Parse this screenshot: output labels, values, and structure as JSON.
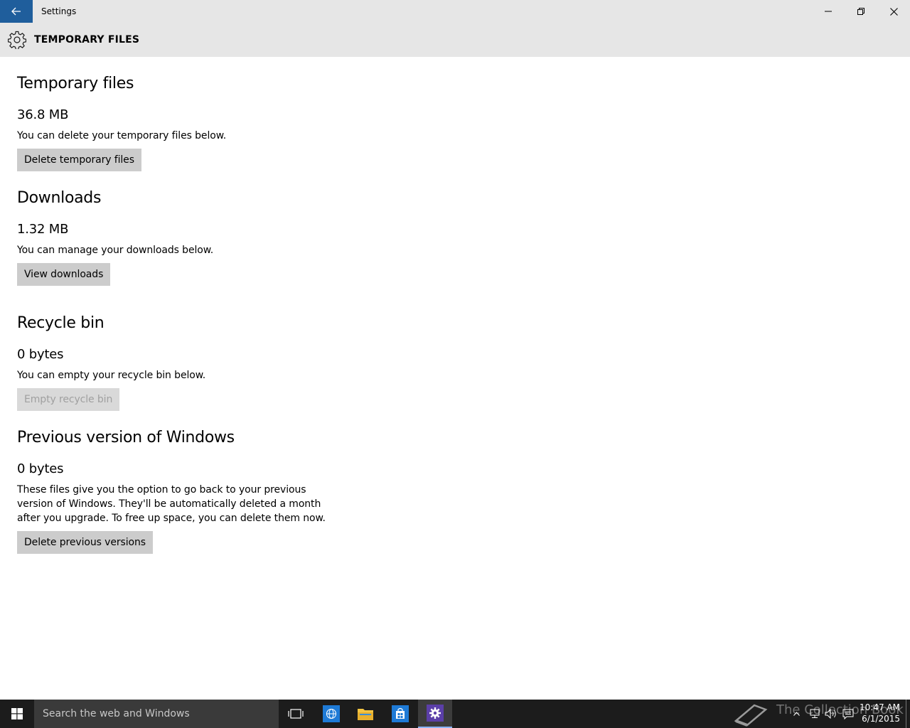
{
  "window": {
    "title": "Settings"
  },
  "header": {
    "title": "TEMPORARY FILES"
  },
  "sections": [
    {
      "heading": "Temporary files",
      "size": "36.8 MB",
      "description": "You can delete your temporary files below.",
      "button": "Delete temporary files",
      "button_enabled": true
    },
    {
      "heading": "Downloads",
      "size": "1.32 MB",
      "description": "You can manage your downloads below.",
      "button": "View downloads",
      "button_enabled": true
    },
    {
      "heading": "Recycle bin",
      "size": "0 bytes",
      "description": "You can empty your recycle bin below.",
      "button": "Empty recycle bin",
      "button_enabled": false
    },
    {
      "heading": "Previous version of Windows",
      "size": "0 bytes",
      "description": "These files give you the option to go back to your previous version of Windows. They'll be automatically deleted a month after you upgrade. To free up space, you can delete them now.",
      "button": "Delete previous versions",
      "button_enabled": true
    }
  ],
  "taskbar": {
    "search_placeholder": "Search the web and Windows",
    "watermark": "The Collection Book",
    "time": "10:47 AM",
    "date": "6/1/2015"
  },
  "colors": {
    "accent": "#1f5e9c",
    "chrome": "#e6e6e6",
    "button": "#cccccc",
    "taskbar": "#1c1c1c"
  }
}
